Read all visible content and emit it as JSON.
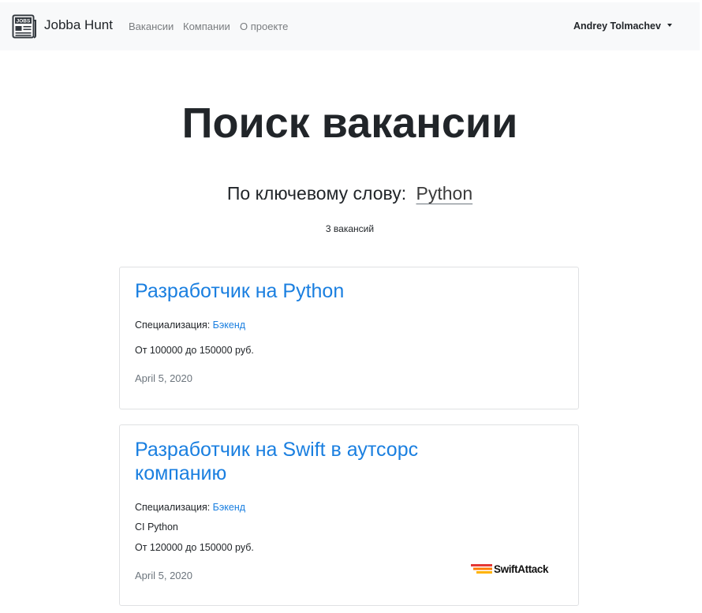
{
  "navbar": {
    "brand_name": "Jobba Hunt",
    "brand_icon_text": "JOBS",
    "links": [
      {
        "label": "Вакансии"
      },
      {
        "label": "Компании"
      },
      {
        "label": "О проекте"
      }
    ],
    "user_name": "Andrey Tolmachev"
  },
  "main": {
    "title": "Поиск вакансии",
    "keyword_label": "По ключевому слову:",
    "keyword_value": "Python",
    "results_count": "3 вакансий"
  },
  "vacancies": [
    {
      "title": "Разработчик на Python",
      "spec_label": "Специализация:",
      "spec_value": "Бэкенд",
      "salary": "От 100000 до 150000 руб.",
      "date": "April 5, 2020"
    },
    {
      "title": "Разработчик на Swift в аутсорс компанию",
      "spec_label": "Специализация:",
      "spec_value": "Бэкенд",
      "skills": "CI Python",
      "salary": "От 120000 до 150000 руб.",
      "date": "April 5, 2020",
      "company_logo_text": "SwiftAttack"
    }
  ],
  "colors": {
    "link": "#1a7fe0",
    "navbar_bg": "#f8f9fa",
    "muted": "#6c757d"
  },
  "icons": {
    "brand": "newspaper-jobs-icon",
    "user_menu": "caret-down-icon",
    "company_logo": "swiftattack-logo"
  }
}
